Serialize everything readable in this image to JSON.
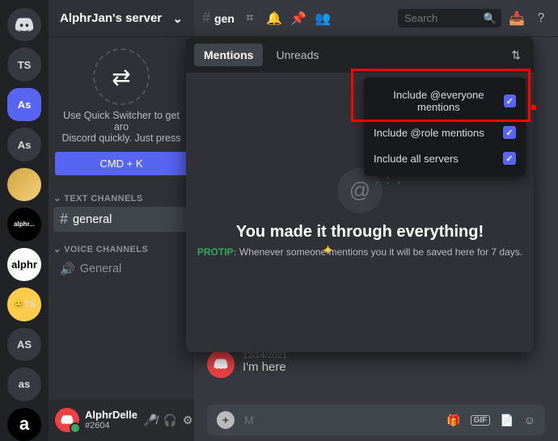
{
  "guild": {
    "name": "AlphrJan's server"
  },
  "servers": [
    {
      "label": "home"
    },
    {
      "label": "TS"
    },
    {
      "label": "As",
      "selected": true
    },
    {
      "label": "As"
    },
    {
      "label": "gold"
    },
    {
      "label": "alphr..."
    },
    {
      "label": "alphr"
    },
    {
      "label": "😊TS"
    },
    {
      "label": "AS"
    },
    {
      "label": "as"
    },
    {
      "label": "a"
    }
  ],
  "quick_switch": {
    "line1": "Use Quick Switcher to get aro",
    "line2": "Discord quickly. Just press",
    "button": "CMD + K"
  },
  "sections": {
    "text_label": "TEXT CHANNELS",
    "voice_label": "VOICE CHANNELS",
    "text_channels": [
      {
        "name": "general",
        "selected": true
      }
    ],
    "voice_channels": [
      {
        "name": "General"
      }
    ]
  },
  "top": {
    "channel": "gen",
    "search_placeholder": "Search"
  },
  "inbox": {
    "tabs": {
      "mentions": "Mentions",
      "unreads": "Unreads"
    },
    "title": "You made it through everything!",
    "protip_label": "PROTIP:",
    "protip_text": "Whenever someone mentions you it will be saved here for 7 days.",
    "filter": {
      "everyone": "Include @everyone mentions",
      "role": "Include @role mentions",
      "servers": "Include all servers"
    }
  },
  "message": {
    "date": "12/14/2021",
    "text": "I'm here"
  },
  "composer": {
    "placeholder": "M",
    "gif": "GIF"
  },
  "user": {
    "name": "AlphrDelle",
    "tag": "#2604"
  }
}
